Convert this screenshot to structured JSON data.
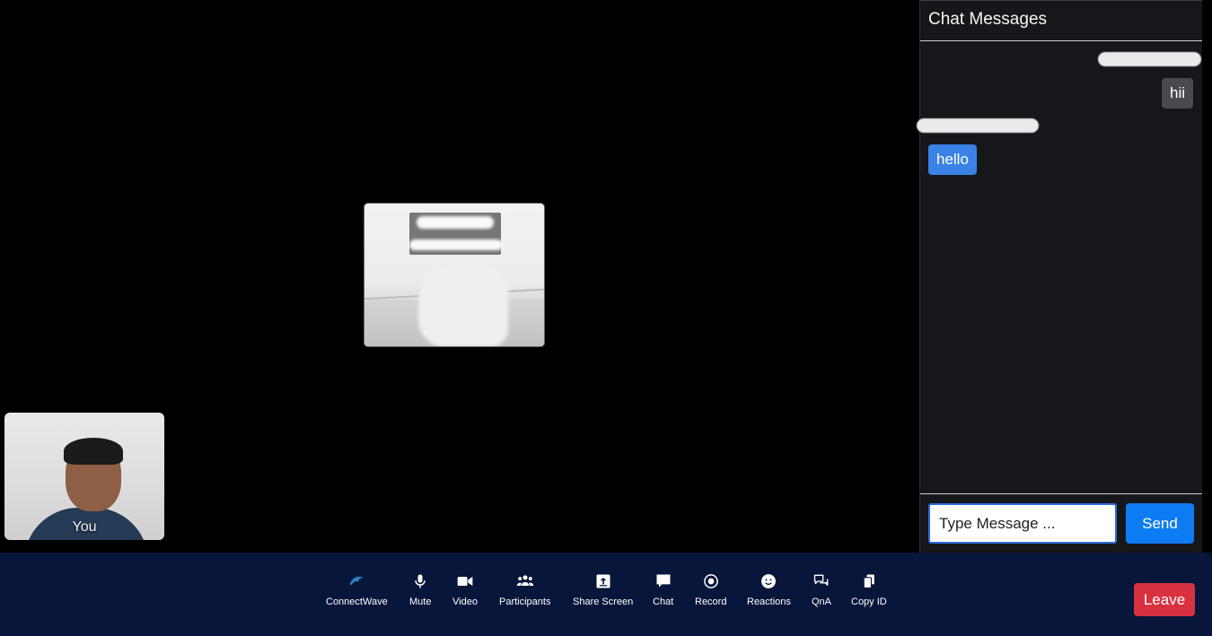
{
  "video": {
    "self_label": "You"
  },
  "chat": {
    "title": "Chat Messages",
    "messages": [
      {
        "side": "right",
        "text": "hii"
      },
      {
        "side": "left",
        "text": "hello"
      }
    ],
    "input_placeholder": "Type Message ...",
    "send_label": "Send"
  },
  "toolbar": {
    "brand_label": "ConnectWave",
    "mute_label": "Mute",
    "video_label": "Video",
    "participants_label": "Participants",
    "share_label": "Share Screen",
    "chat_label": "Chat",
    "record_label": "Record",
    "reactions_label": "Reactions",
    "qna_label": "QnA",
    "copy_label": "Copy ID",
    "leave_label": "Leave"
  },
  "colors": {
    "toolbar_bg": "#07163a",
    "send_button": "#0d7bf2",
    "leave_button": "#d8313f",
    "own_message": "#484a4f",
    "other_message": "#3b82e6"
  }
}
